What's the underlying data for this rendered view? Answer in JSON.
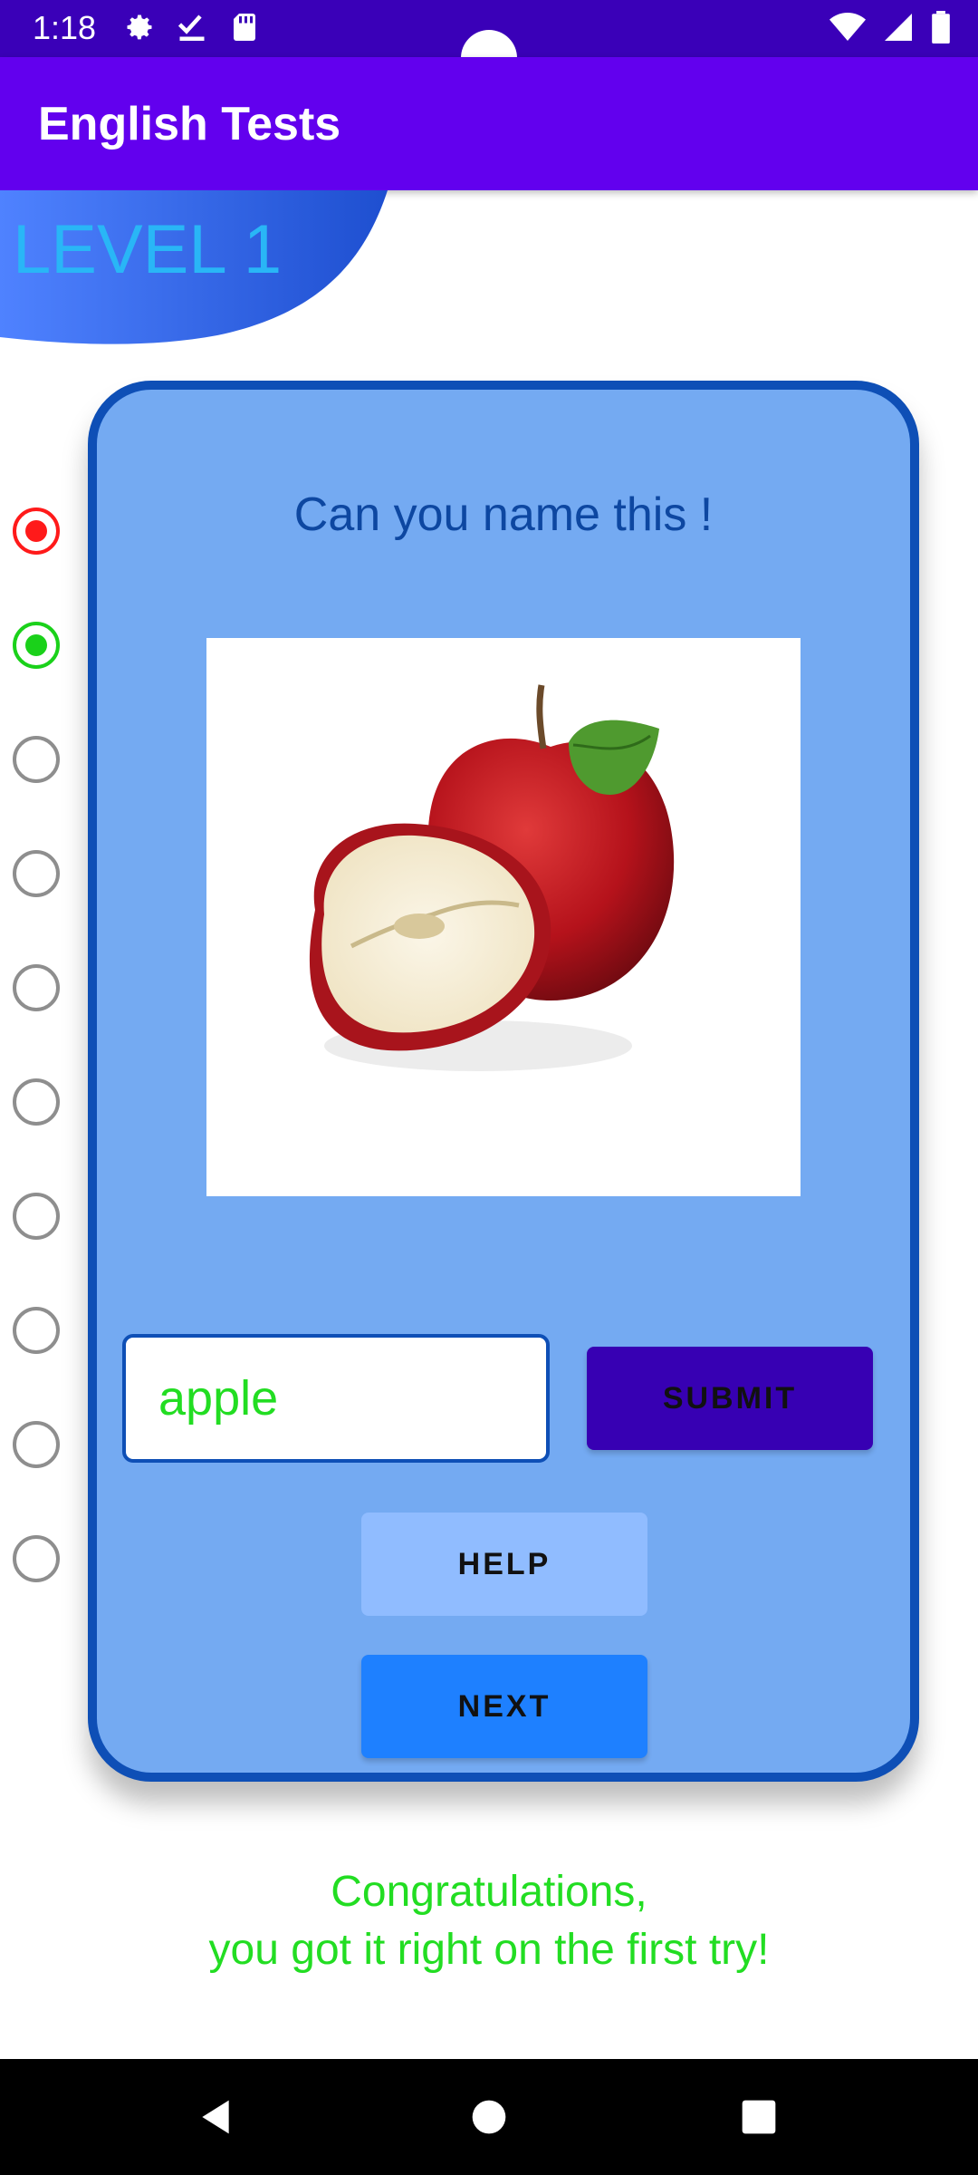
{
  "status_bar": {
    "time": "1:18",
    "left_icons": [
      "gear-icon",
      "check-download-icon",
      "sd-card-icon"
    ],
    "right_icons": [
      "wifi-icon",
      "cell-signal-icon",
      "battery-icon"
    ]
  },
  "app_bar": {
    "title": "English Tests"
  },
  "level": {
    "label": "LEVEL 1"
  },
  "progress": {
    "items": [
      {
        "state": "wrong",
        "color": "#ff1a1a"
      },
      {
        "state": "correct",
        "color": "#1ad11a"
      },
      {
        "state": "empty"
      },
      {
        "state": "empty"
      },
      {
        "state": "empty"
      },
      {
        "state": "empty"
      },
      {
        "state": "empty"
      },
      {
        "state": "empty"
      },
      {
        "state": "empty"
      },
      {
        "state": "empty"
      }
    ]
  },
  "card": {
    "question": "Can you name this !",
    "image": "apple-photo",
    "answer_value": "apple",
    "submit_label": "SUBMIT",
    "help_label": "HELP",
    "next_label": "NEXT"
  },
  "feedback": {
    "line1": "Congratulations,",
    "line2": "you got it right on the first try!",
    "color": "#22dd22"
  },
  "nav_bar": {
    "icons": [
      "back-icon",
      "home-icon",
      "recents-icon"
    ]
  }
}
